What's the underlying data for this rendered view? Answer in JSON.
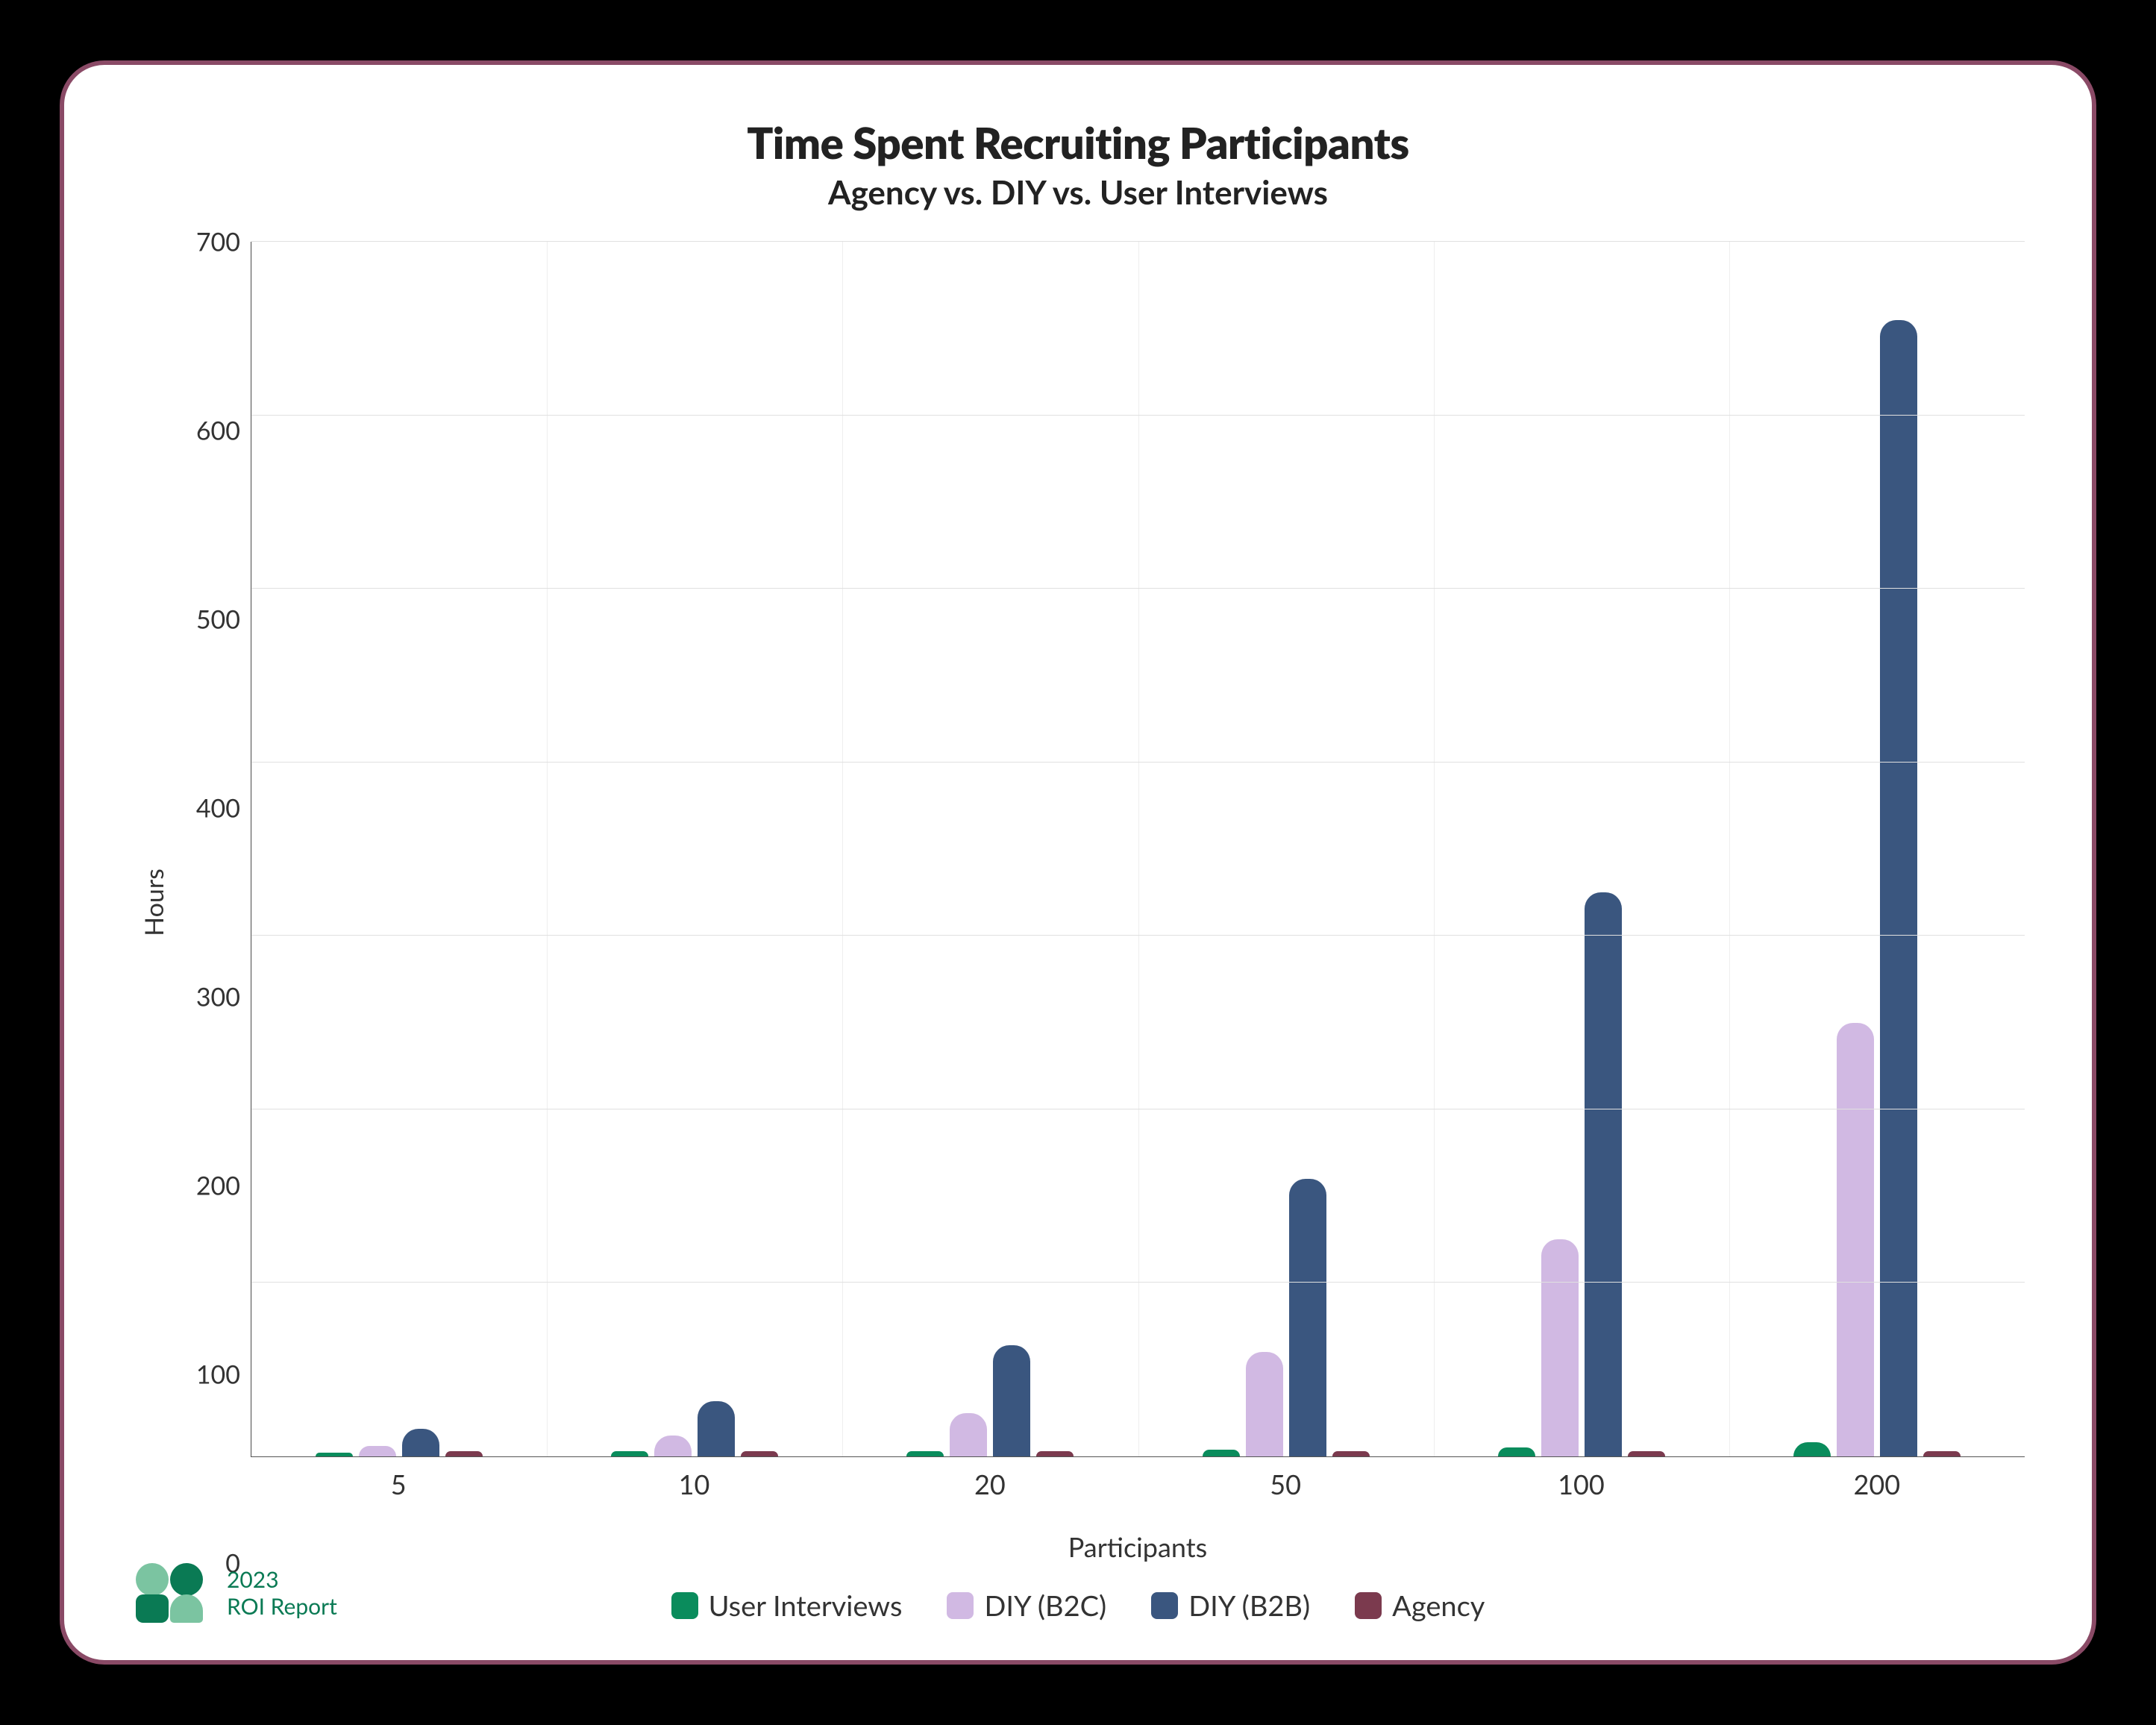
{
  "title": "Time Spent Recruiting Participants",
  "subtitle": "Agency vs. DIY vs. User Interviews",
  "xlabel": "Participants",
  "ylabel": "Hours",
  "brand": {
    "line1": "2023",
    "line2": "ROI Report"
  },
  "legend": [
    {
      "name": "User Interviews",
      "colorClass": "c-ui"
    },
    {
      "name": "DIY (B2C)",
      "colorClass": "c-b2c"
    },
    {
      "name": "DIY (B2B)",
      "colorClass": "c-b2b"
    },
    {
      "name": "Agency",
      "colorClass": "c-agency"
    }
  ],
  "chart_data": {
    "type": "bar",
    "title": "Time Spent Recruiting Participants",
    "subtitle": "Agency vs. DIY vs. User Interviews",
    "xlabel": "Participants",
    "ylabel": "Hours",
    "ylim": [
      0,
      700
    ],
    "yticks": [
      0,
      100,
      200,
      300,
      400,
      500,
      600,
      700
    ],
    "categories": [
      "5",
      "10",
      "20",
      "50",
      "100",
      "200"
    ],
    "series": [
      {
        "name": "User Interviews",
        "color": "#0a8c5c",
        "values": [
          2,
          3,
          3,
          4,
          5,
          8
        ]
      },
      {
        "name": "DIY (B2C)",
        "color": "#d1b9e3",
        "values": [
          6,
          12,
          25,
          60,
          125,
          250
        ]
      },
      {
        "name": "DIY (B2B)",
        "color": "#3a567f",
        "values": [
          16,
          32,
          64,
          160,
          325,
          655
        ]
      },
      {
        "name": "Agency",
        "color": "#7b3a4e",
        "values": [
          3,
          3,
          3,
          3,
          3,
          3
        ]
      }
    ],
    "legend_position": "bottom",
    "grid": true
  }
}
